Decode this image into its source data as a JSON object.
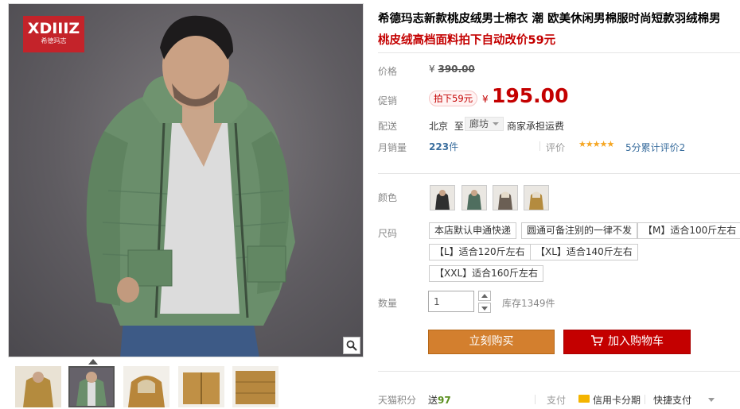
{
  "brand": {
    "mark": "XDIIIZ",
    "sub": "希德玛志"
  },
  "product": {
    "title": "希德玛志新款桃皮绒男士棉衣 潮 欧美休闲男棉服时尚短款羽绒棉男",
    "subtitle": "桃皮绒高档面料拍下自动改价59元"
  },
  "price": {
    "label": "价格",
    "currency": "¥",
    "original": "390.00"
  },
  "promo": {
    "label": "促销",
    "tag": "拍下59元",
    "currency": "¥",
    "price": "195.00"
  },
  "shipping": {
    "label": "配送",
    "from": "北京",
    "to_word": "至",
    "destination": "廊坊",
    "fee": "商家承担运费"
  },
  "sales": {
    "label": "月销量",
    "count": "223",
    "unit": "件",
    "review_label": "评价",
    "stars": "★★★★★",
    "review_text": "5分累计评价2"
  },
  "color": {
    "label": "颜色",
    "swatches": [
      "black-jacket",
      "green-jacket",
      "grey-jacket",
      "khaki-jacket"
    ]
  },
  "size": {
    "label": "尺码",
    "options": [
      "本店默认申通快递",
      "圆通可备注别的一律不发",
      "【M】适合100斤左右",
      "【L】适合120斤左右",
      "【XL】适合140斤左右",
      "【XXL】适合160斤左右"
    ]
  },
  "quantity": {
    "label": "数量",
    "value": "1",
    "stock": "库存1349件"
  },
  "actions": {
    "buy_now": "立刻购买",
    "add_to_cart": "加入购物车"
  },
  "points": {
    "label": "天猫积分",
    "prefix": "送",
    "value": "97"
  },
  "payment": {
    "label": "支付",
    "card": "信用卡分期",
    "quick": "快捷支付"
  },
  "colors": {
    "accent_red": "#c40000",
    "buy_orange": "#d37f2e",
    "jacket_green": "#6a8e6b"
  }
}
